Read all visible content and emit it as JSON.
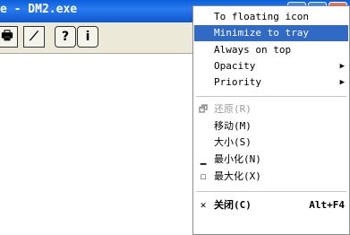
{
  "window": {
    "title": "e - DM2.exe"
  },
  "toolbar": {
    "tools": [
      {
        "name": "print-tool",
        "glyph": "🖶"
      },
      {
        "name": "chart-tool",
        "glyph": "⟋"
      },
      {
        "name": "help-tool",
        "glyph": "?"
      },
      {
        "name": "info-tool",
        "glyph": "i"
      }
    ]
  },
  "menu": {
    "items": [
      {
        "label": "To floating icon"
      },
      {
        "label": "Minimize to tray"
      },
      {
        "label": "Always on top"
      },
      {
        "label": "Opacity",
        "arrow": "▶"
      },
      {
        "label": "Priority",
        "arrow": "▶"
      }
    ],
    "system": [
      {
        "label": "还原(R)",
        "icon": "🗗"
      },
      {
        "label": "移动(M)"
      },
      {
        "label": "大小(S)"
      },
      {
        "label": "最小化(N)",
        "icon": "▁"
      },
      {
        "label": "最大化(X)",
        "icon": "☐"
      }
    ],
    "close": {
      "label": "关闭(C)",
      "icon": "✕",
      "shortcut": "Alt+F4"
    }
  }
}
